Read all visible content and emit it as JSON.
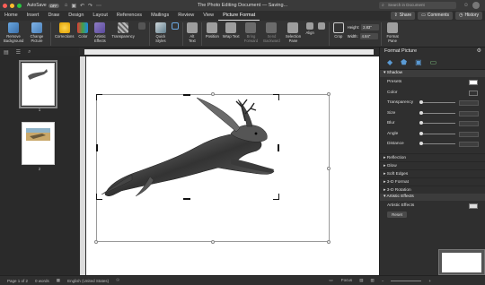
{
  "window": {
    "autosave_label": "AutoSave",
    "autosave_state": "OFF",
    "doc_title": "The Photo Editing Document — Saving...",
    "search_placeholder": "Search in Document"
  },
  "tabs": [
    "Home",
    "Insert",
    "Draw",
    "Design",
    "Layout",
    "References",
    "Mailings",
    "Review",
    "View",
    "Picture Format"
  ],
  "active_tab": "Picture Format",
  "top_buttons": {
    "share": "Share",
    "comments": "Comments",
    "history": "History"
  },
  "ribbon": {
    "remove_bg": "Remove Background",
    "change_pic": "Change Picture",
    "corrections": "Corrections",
    "color": "Color",
    "artistic": "Artistic Effects",
    "transparency": "Transparency",
    "quick_styles": "Quick Styles",
    "alt_text": "Alt Text",
    "position": "Position",
    "wrap_text": "Wrap Text",
    "bring_forward": "Bring Forward",
    "send_backward": "Send Backward",
    "selection_pane": "Selection Pane",
    "align": "Align",
    "crop": "Crop",
    "height_label": "Height:",
    "height_val": "2.83\"",
    "width_label": "Width:",
    "width_val": "4.84\"",
    "format_pane": "Format Pane"
  },
  "thumbnails": {
    "page1_num": "1",
    "page2_num": "2"
  },
  "format_pane": {
    "title": "Format Picture",
    "shadow_header": "Shadow",
    "rows": {
      "presets": "Presets",
      "color": "Color",
      "transparency": "Transparency",
      "size": "Size",
      "blur": "Blur",
      "angle": "Angle",
      "distance": "Distance"
    },
    "collapsed": [
      "Reflection",
      "Glow",
      "Soft Edges",
      "3-D Format",
      "3-D Rotation"
    ],
    "artistic_header": "Artistic Effects",
    "artistic_row": "Artistic Effects",
    "reset": "Reset"
  },
  "status": {
    "page": "Page 1 of 2",
    "words": "0 words",
    "language": "English (United States)",
    "focus": "Focus",
    "zoom": "+"
  },
  "colors": {
    "traffic_red": "#ff5f57",
    "traffic_yellow": "#febc2e",
    "traffic_green": "#28c840"
  }
}
